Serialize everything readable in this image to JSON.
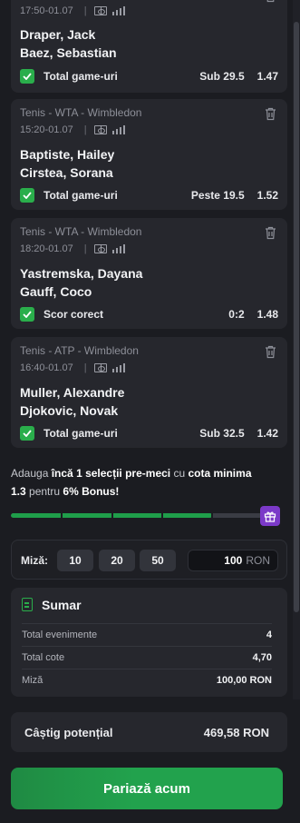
{
  "bets": [
    {
      "league": "",
      "time": "17:50-01.07",
      "team1": "Draper, Jack",
      "team2": "Baez, Sebastian",
      "market": "Total game-uri",
      "selection": "Sub 29.5",
      "odd": "1.47"
    },
    {
      "league": "Tenis - WTA - Wimbledon",
      "time": "15:20-01.07",
      "team1": "Baptiste, Hailey",
      "team2": "Cirstea, Sorana",
      "market": "Total game-uri",
      "selection": "Peste 19.5",
      "odd": "1.52"
    },
    {
      "league": "Tenis - WTA - Wimbledon",
      "time": "18:20-01.07",
      "team1": "Yastremska, Dayana",
      "team2": "Gauff, Coco",
      "market": "Scor corect",
      "selection": "0:2",
      "odd": "1.48"
    },
    {
      "league": "Tenis - ATP - Wimbledon",
      "time": "16:40-01.07",
      "team1": "Muller, Alexandre",
      "team2": "Djokovic, Novak",
      "market": "Total game-uri",
      "selection": "Sub 32.5",
      "odd": "1.42"
    }
  ],
  "bonus": {
    "prefix": "Adauga ",
    "count_text": "încă 1 selecții pre-meci",
    "middle": " cu ",
    "min_odd_label": "cota minima",
    "min_odd": "1.3",
    "for": " pentru ",
    "bonus_pct": "6% Bonus!",
    "progress_fraction": 0.8
  },
  "stake": {
    "label": "Miză:",
    "chips": [
      "10",
      "20",
      "50"
    ],
    "amount": "100",
    "currency": "RON"
  },
  "summary": {
    "title": "Sumar",
    "rows": [
      {
        "label": "Total evenimente",
        "value": "4"
      },
      {
        "label": "Total cote",
        "value": "4,70"
      },
      {
        "label": "Miză",
        "value": "100,00 RON"
      }
    ]
  },
  "potential_win": {
    "label": "Câștig potențial",
    "value": "469,58 RON"
  },
  "place_bet_label": "Pariază acum",
  "colors": {
    "accent": "#2aae4b",
    "bonus_purple": "#7b39c8",
    "background": "#1b1c21",
    "card": "#26272d"
  }
}
